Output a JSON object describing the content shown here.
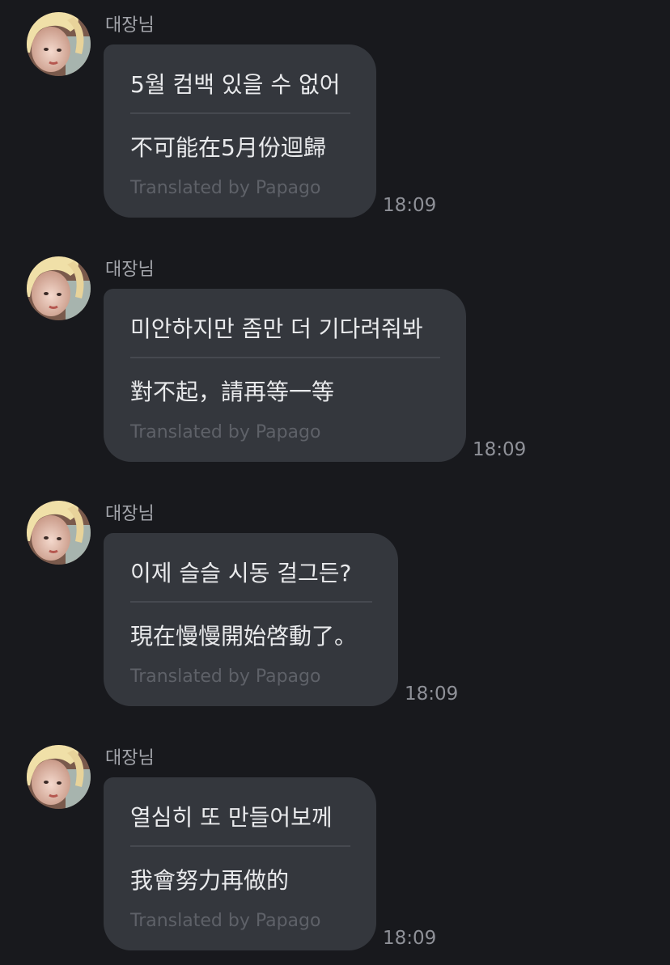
{
  "chat": {
    "messages": [
      {
        "sender": "대장님",
        "text": "5월 컴백 있을 수 없어",
        "translation": "不可能在5月份迴歸",
        "translation_credit": "Translated by Papago",
        "time": "18:09"
      },
      {
        "sender": "대장님",
        "text": "미안하지만 좀만 더 기다려줘봐",
        "translation": "對不起，請再等一等",
        "translation_credit": "Translated by Papago",
        "time": "18:09"
      },
      {
        "sender": "대장님",
        "text": "이제 슬슬 시동 걸그든?",
        "translation": "現在慢慢開始啓動了。",
        "translation_credit": "Translated by Papago",
        "time": "18:09"
      },
      {
        "sender": "대장님",
        "text": "열심히 또 만들어보께",
        "translation": "我會努力再做的",
        "translation_credit": "Translated by Papago",
        "time": "18:09"
      }
    ]
  }
}
